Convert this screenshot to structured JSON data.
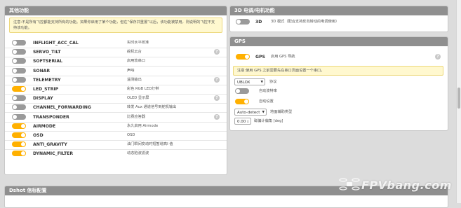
{
  "other_features": {
    "title": "其他功能",
    "notice": "注意:不是所有飞控都能支持所有的功能。如果你启用了某个功能，但在“保存并重置”以后，该功能被禁用，则说明的飞控不支持该功能。",
    "features": [
      {
        "name": "INFLIGHT_ACC_CAL",
        "desc": "实时水平校准",
        "on": false,
        "help": false
      },
      {
        "name": "SERVO_TILT",
        "desc": "舵机云台",
        "on": false,
        "help": true
      },
      {
        "name": "SOFTSERIAL",
        "desc": "启用软串口",
        "on": false,
        "help": false
      },
      {
        "name": "SONAR",
        "desc": "声呐",
        "on": false,
        "help": false
      },
      {
        "name": "TELEMETRY",
        "desc": "遥测输出",
        "on": false,
        "help": true
      },
      {
        "name": "LED_STRIP",
        "desc": "彩色 RGB LED灯带",
        "on": true,
        "help": false
      },
      {
        "name": "DISPLAY",
        "desc": "OLED 显示屏",
        "on": false,
        "help": true
      },
      {
        "name": "CHANNEL_FORWARDING",
        "desc": "转发 Aux 通道信号到舵机输出",
        "on": false,
        "help": false
      },
      {
        "name": "TRANSPONDER",
        "desc": "比赛应答器",
        "on": false,
        "help": true
      },
      {
        "name": "AIRMODE",
        "desc": "永久启用 Airmode",
        "on": true,
        "help": false
      },
      {
        "name": "OSD",
        "desc": "OSD",
        "on": true,
        "help": false
      },
      {
        "name": "ANTI_GRAVITY",
        "desc": "油门瞬间变动时短暂增高I 值",
        "on": true,
        "help": false
      },
      {
        "name": "DYNAMIC_FILTER",
        "desc": "动态陷波滤波",
        "on": true,
        "help": false
      }
    ]
  },
  "motor_3d": {
    "title": "3D 电调/电机功能",
    "name": "3D",
    "desc": "3D 模式（配合支持反向转动的电调使用）",
    "on": false
  },
  "gps": {
    "title": "GPS",
    "name": "GPS",
    "desc": "启用 GPS 导航",
    "on": true,
    "notice": "注意:使用 GPS 之前需要先在串口页面设置一个串口。",
    "protocol_value": "UBLOX",
    "protocol_label": "协议",
    "auto_baud_label": "自动波特率",
    "auto_baud_on": false,
    "auto_config_label": "自动设置",
    "auto_config_on": true,
    "sbas_value": "Auto-detect",
    "sbas_label": "地面辅助类型",
    "declination_value": "0.00",
    "declination_label": "磁偏计偏角 [deg]"
  },
  "dshot": {
    "title": "Dshot 信标配置"
  },
  "watermark": "FPVbang.com",
  "colors": {
    "toggle_on": "#ffb000",
    "toggle_off": "#9a9a9a",
    "header": "#8f8f8f",
    "notice_bg": "#fff8cf"
  }
}
